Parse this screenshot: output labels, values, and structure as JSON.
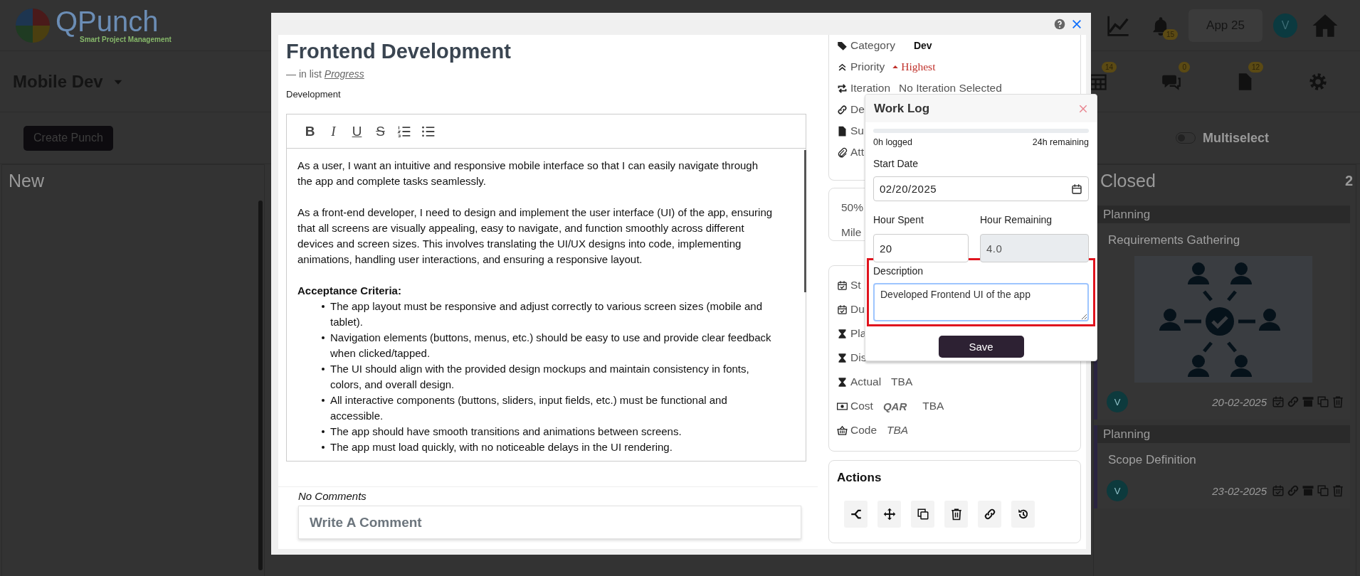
{
  "header": {
    "logo_title": "QPunch",
    "logo_subtitle": "Smart Project Management",
    "notifications": "15",
    "app_button": "App 25",
    "avatar": "V"
  },
  "project_bar": {
    "project": "Mobile Dev",
    "shortcuts": [
      {
        "kind": "calendar",
        "count": "14"
      },
      {
        "kind": "chat",
        "count": "0"
      },
      {
        "kind": "document",
        "count": "12"
      },
      {
        "kind": "settings"
      }
    ]
  },
  "toolbar": {
    "create_button": "Create Punch",
    "multiselect": {
      "label": "Multiselect",
      "on": false
    }
  },
  "columns": [
    {
      "title": "New"
    },
    {
      "title": "Closed",
      "count": "2",
      "cards": [
        {
          "tag": "Planning",
          "title": "Requirements Gathering",
          "image": true,
          "avatar": "V",
          "date": "20-02-2025"
        },
        {
          "tag": "Planning",
          "title": "Scope Definition",
          "avatar": "V",
          "date": "23-02-2025"
        }
      ]
    }
  ],
  "punch_modal": {
    "title": "Frontend Development",
    "list_prefix": "— in list",
    "list_link": "Progress",
    "category": "Development",
    "editor": {
      "format_buttons": [
        {
          "kind": "bold",
          "label": "B"
        },
        {
          "kind": "italic",
          "label": "I"
        },
        {
          "kind": "underline",
          "label": "U"
        },
        {
          "kind": "strike",
          "label": "S"
        },
        {
          "kind": "ordered_list"
        },
        {
          "kind": "bullet_list"
        }
      ],
      "paragraphs": [
        "As a user, I want an intuitive and responsive mobile interface so that I can easily navigate through the app and complete tasks seamlessly.",
        "As a front-end developer, I need to design and implement the user interface (UI) of the app, ensuring that all screens are visually appealing, easy to navigate, and function smoothly across different devices and screen sizes. This involves translating the UI/UX designs into code, implementing animations, handling user interactions, and ensuring a responsive layout."
      ],
      "criteria_heading": "Acceptance Criteria:",
      "criteria": [
        "The app layout must be responsive and adjust correctly to various screen sizes (mobile and tablet).",
        "Navigation elements (buttons, menus, etc.) should be easy to use and provide clear feedback when clicked/tapped.",
        "The UI should align with the provided design mockups and maintain consistency in fonts, colors, and overall design.",
        "All interactive components (buttons, sliders, input fields, etc.) must be functional and accessible.",
        "The app should have smooth transitions and animations between screens.",
        "The app must load quickly, with no noticeable delays in the UI rendering."
      ]
    },
    "comments_status": "No Comments",
    "comment_placeholder": "Write A Comment",
    "details": [
      {
        "kind": "category",
        "label": "Category",
        "value": "Dev"
      },
      {
        "kind": "priority",
        "label": "Priority",
        "value": "Highest"
      },
      {
        "kind": "iteration",
        "label": "Iteration",
        "value": "No Iteration Selected"
      },
      {
        "kind": "link",
        "label": "De"
      },
      {
        "kind": "file",
        "label": "Su"
      },
      {
        "kind": "attachment",
        "label": "Att"
      }
    ],
    "progress_card": {
      "percent": "50%",
      "milestone_label": "Mile"
    },
    "schedule": [
      {
        "kind": "calendar",
        "label": "St"
      },
      {
        "kind": "calendar",
        "label": "Du"
      },
      {
        "kind": "hourglass",
        "label": "Pla"
      },
      {
        "kind": "hourglass",
        "label": "Dis"
      },
      {
        "kind": "hourglass",
        "label": "Actual",
        "value": "TBA"
      },
      {
        "kind": "cost",
        "label": "Cost",
        "currency": "QAR",
        "value": "TBA"
      },
      {
        "kind": "code",
        "label": "Code",
        "value": "TBA"
      }
    ],
    "actions": {
      "title": "Actions",
      "buttons": [
        {
          "kind": "branch"
        },
        {
          "kind": "move"
        },
        {
          "kind": "copy"
        },
        {
          "kind": "delete"
        },
        {
          "kind": "link"
        },
        {
          "kind": "history"
        }
      ]
    }
  },
  "work_log": {
    "title": "Work Log",
    "level": 0,
    "logged": "0h logged",
    "remaining": "24h remaining",
    "start_date": {
      "label": "Start Date",
      "value": "02/20/2025"
    },
    "hour_spent": {
      "label": "Hour Spent",
      "value": "20"
    },
    "hour_remaining": {
      "label": "Hour Remaining",
      "value": "4.0",
      "disabled": true
    },
    "description": {
      "label": "Description",
      "value": "Developed Frontend UI of the app",
      "highlighted": true
    },
    "save_button": "Save"
  }
}
